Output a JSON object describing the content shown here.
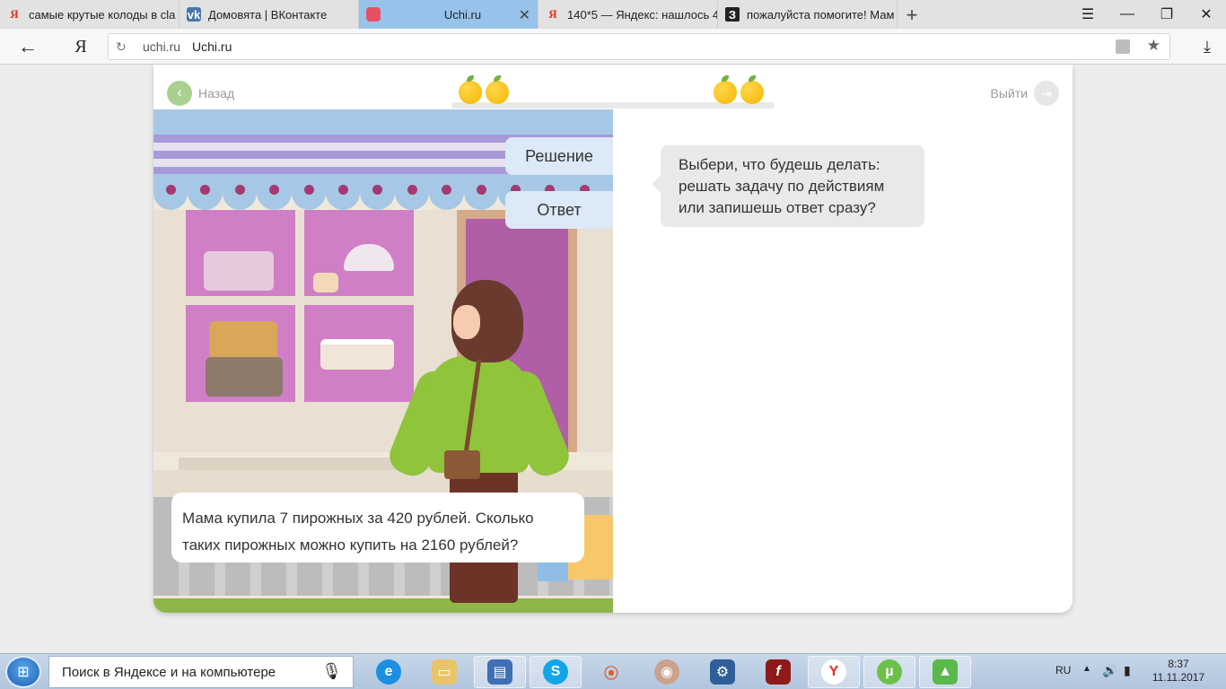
{
  "browser": {
    "tabs": [
      {
        "title": "самые крутые колоды в cla",
        "favicon": "yandex-icon",
        "active": false
      },
      {
        "title": "Домовята | ВКонтакте",
        "favicon": "vk-icon",
        "active": false
      },
      {
        "title": "Uchi.ru",
        "favicon": "uchi-icon",
        "active": true
      },
      {
        "title": "140*5 — Яндекс: нашлось 4",
        "favicon": "yandex-icon",
        "active": false
      },
      {
        "title": "пожалуйста помогите! Мам",
        "favicon": "znanija-icon",
        "active": false
      }
    ],
    "address": {
      "domain": "uchi.ru",
      "page_title": "Uchi.ru"
    },
    "yandex_glyph": "Я",
    "accent_color": "#97c3ea"
  },
  "page": {
    "back_label": "Назад",
    "exit_label": "Выйти",
    "progress_fruits": 4,
    "options": [
      {
        "label": "Решение"
      },
      {
        "label": "Ответ"
      }
    ],
    "problem_text": "Мама купила 7 пирожных за 420 рублей. Сколько таких пирожных можно купить на 2160 рублей?",
    "speech_text": "Выбери, что будешь делать: решать задачу по действиям или запишешь ответ сразу?"
  },
  "taskbar": {
    "search_placeholder": "Поиск в Яндексе и на компьютере",
    "language": "RU",
    "time": "8:37",
    "date": "11.11.2017",
    "apps": [
      "internet-explorer-icon",
      "file-explorer-icon",
      "network-icon",
      "skype-icon",
      "share-icon",
      "cake-icon",
      "settings-icon",
      "flash-icon",
      "yandex-browser-icon",
      "utorrent-icon",
      "avast-icon"
    ]
  }
}
